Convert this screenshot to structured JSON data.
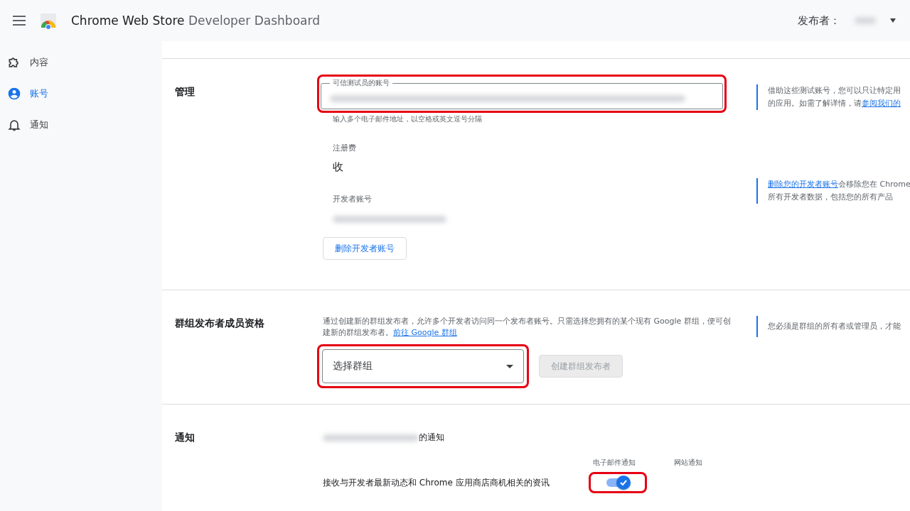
{
  "header": {
    "title_bold": "Chrome Web Store",
    "title_light": "Developer Dashboard",
    "publisher_label": "发布者："
  },
  "sidebar": {
    "items": [
      {
        "label": "内容",
        "kind": "puzzle",
        "selected": false
      },
      {
        "label": "账号",
        "kind": "account",
        "selected": true
      },
      {
        "label": "通知",
        "kind": "bell",
        "selected": false
      }
    ]
  },
  "manage": {
    "title": "管理",
    "testers_field": {
      "label": "可信测试员的账号",
      "hint": "输入多个电子邮件地址，以空格或英文逗号分隔"
    },
    "testers_note": {
      "text": "借助这些测试账号，您可以只让特定用",
      "text2": "的应用。如需了解详情，请",
      "link": "参阅我们的"
    },
    "fee_label": "注册费",
    "fee_value": "收",
    "developer_label": "开发者账号",
    "delete_button": "删除开发者账号",
    "delete_note": {
      "link": "删除您的开发者账号",
      "text": "会移除您在 Chrome",
      "text2": "所有开发者数据，包括您的所有产品"
    }
  },
  "group": {
    "title": "群组发布者成员资格",
    "description": "通过创建新的群组发布者，允许多个开发者访问同一个发布者账号。只需选择您拥有的某个现有 Google 群组，便可创建新的群组发布者。",
    "link": "前往 Google 群组",
    "select_placeholder": "选择群组",
    "create_button": {
      "label": "创建群组发布者",
      "disabled": true
    },
    "note": "您必须是群组的所有者或管理员，才能"
  },
  "notifications": {
    "title": "通知",
    "email_suffix": "的通知",
    "columns": [
      "电子邮件通知",
      "网站通知"
    ],
    "rows": [
      {
        "label": "接收与开发者最新动态和 Chrome 应用商店商机相关的资讯",
        "email_on": true
      }
    ]
  }
}
